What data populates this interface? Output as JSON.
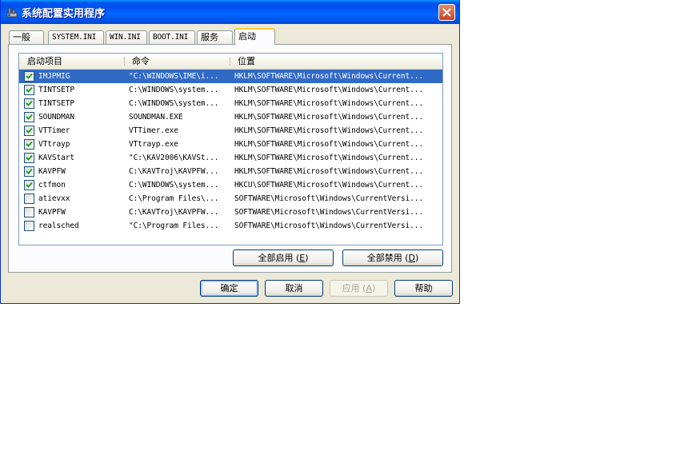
{
  "window": {
    "title": "系统配置实用程序"
  },
  "tabs": [
    {
      "label": "一般"
    },
    {
      "label": "SYSTEM.INI"
    },
    {
      "label": "WIN.INI"
    },
    {
      "label": "BOOT.INI"
    },
    {
      "label": "服务"
    },
    {
      "label": "启动"
    }
  ],
  "columns": {
    "item": "启动项目",
    "command": "命令",
    "location": "位置"
  },
  "rows": [
    {
      "checked": true,
      "item": "IMJPMIG",
      "command": "\"C:\\WINDOWS\\IME\\i...",
      "location": "HKLM\\SOFTWARE\\Microsoft\\Windows\\Current..."
    },
    {
      "checked": true,
      "item": "TINTSETP",
      "command": "C:\\WINDOWS\\system...",
      "location": "HKLM\\SOFTWARE\\Microsoft\\Windows\\Current..."
    },
    {
      "checked": true,
      "item": "TINTSETP",
      "command": "C:\\WINDOWS\\system...",
      "location": "HKLM\\SOFTWARE\\Microsoft\\Windows\\Current..."
    },
    {
      "checked": true,
      "item": "SOUNDMAN",
      "command": "SOUNDMAN.EXE",
      "location": "HKLM\\SOFTWARE\\Microsoft\\Windows\\Current..."
    },
    {
      "checked": true,
      "item": "VTTimer",
      "command": "VTTimer.exe",
      "location": "HKLM\\SOFTWARE\\Microsoft\\Windows\\Current..."
    },
    {
      "checked": true,
      "item": "VTtrayp",
      "command": "VTtrayp.exe",
      "location": "HKLM\\SOFTWARE\\Microsoft\\Windows\\Current..."
    },
    {
      "checked": true,
      "item": "KAVStart",
      "command": "\"C:\\KAV2006\\KAVSt...",
      "location": "HKLM\\SOFTWARE\\Microsoft\\Windows\\Current..."
    },
    {
      "checked": true,
      "item": "KAVPFW",
      "command": "C:\\KAVTroj\\KAVPFW...",
      "location": "HKLM\\SOFTWARE\\Microsoft\\Windows\\Current..."
    },
    {
      "checked": true,
      "item": "ctfmon",
      "command": "C:\\WINDOWS\\system...",
      "location": "HKCU\\SOFTWARE\\Microsoft\\Windows\\Current..."
    },
    {
      "checked": false,
      "item": "atievxx",
      "command": "C:\\Program Files\\...",
      "location": "SOFTWARE\\Microsoft\\Windows\\CurrentVersi..."
    },
    {
      "checked": false,
      "item": "KAVPFW",
      "command": "C:\\KAVTroj\\KAVPFW...",
      "location": "SOFTWARE\\Microsoft\\Windows\\CurrentVersi..."
    },
    {
      "checked": false,
      "item": "realsched",
      "command": "\"C:\\Program Files...",
      "location": "SOFTWARE\\Microsoft\\Windows\\CurrentVersi..."
    }
  ],
  "buttons": {
    "enable_all": {
      "label": "全部启用 (",
      "key": "E",
      "tail": ")"
    },
    "disable_all": {
      "label": "全部禁用 (",
      "key": "D",
      "tail": ")"
    },
    "ok": "确定",
    "cancel": "取消",
    "apply": {
      "label": "应用 (",
      "key": "A",
      "tail": ")"
    },
    "help": "帮助"
  },
  "colors": {
    "titlebar": "#0053ee",
    "selection": "#316ac5",
    "face": "#ece9d8",
    "active_tab_accent": "#ffc83c"
  }
}
